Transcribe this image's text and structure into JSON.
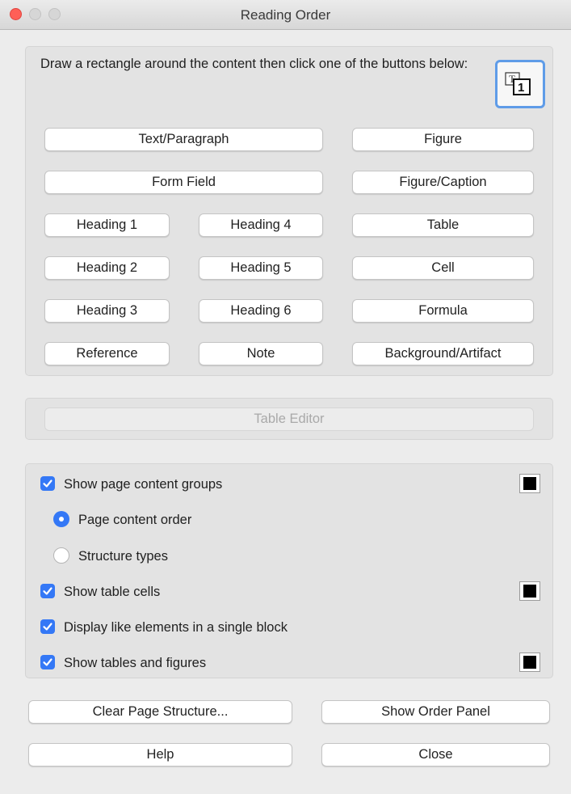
{
  "window": {
    "title": "Reading Order"
  },
  "tagging": {
    "instruction": "Draw a rectangle around the content then click one of the buttons below:",
    "buttons": {
      "text_paragraph": "Text/Paragraph",
      "figure": "Figure",
      "form_field": "Form Field",
      "figure_caption": "Figure/Caption",
      "heading_1": "Heading 1",
      "heading_4": "Heading 4",
      "table": "Table",
      "heading_2": "Heading 2",
      "heading_5": "Heading 5",
      "cell": "Cell",
      "heading_3": "Heading 3",
      "heading_6": "Heading 6",
      "formula": "Formula",
      "reference": "Reference",
      "note": "Note",
      "background_artifact": "Background/Artifact"
    }
  },
  "table_editor": {
    "label": "Table Editor",
    "enabled": false
  },
  "display_options": {
    "show_page_content_groups": {
      "label": "Show page content groups",
      "checked": true,
      "color": "#000000"
    },
    "page_content_order": {
      "label": "Page content order",
      "selected": true
    },
    "structure_types": {
      "label": "Structure types",
      "selected": false
    },
    "show_table_cells": {
      "label": "Show table cells",
      "checked": true,
      "color": "#000000"
    },
    "display_like_elements": {
      "label": "Display like elements in a single block",
      "checked": true
    },
    "show_tables_figures": {
      "label": "Show tables and figures",
      "checked": true,
      "color": "#000000"
    }
  },
  "footer": {
    "clear_structure": "Clear Page Structure...",
    "show_order_panel": "Show Order Panel",
    "help": "Help",
    "close": "Close"
  },
  "colors": {
    "accent": "#3478f6",
    "focus_ring": "#5f9ce8"
  }
}
